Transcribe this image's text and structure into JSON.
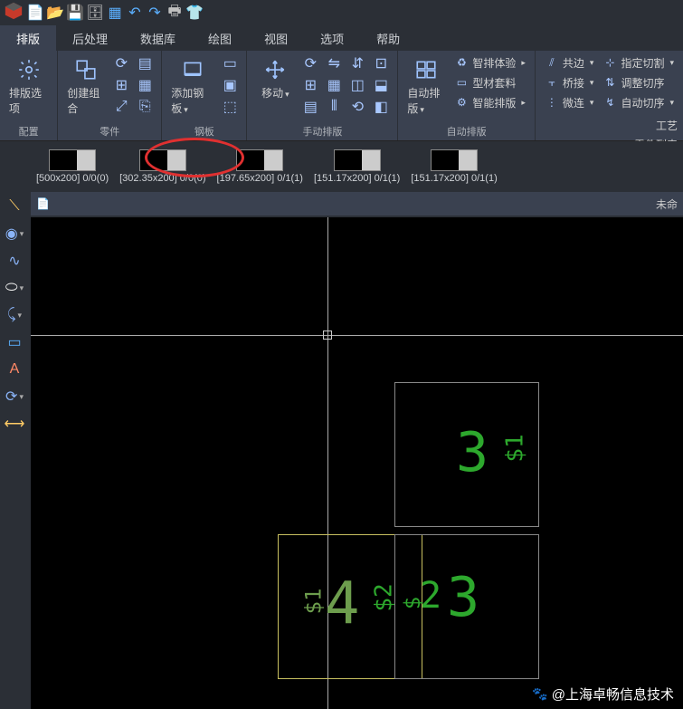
{
  "qat": {
    "items": [
      "new",
      "open",
      "save",
      "saveall",
      "grid",
      "undo",
      "redo",
      "print",
      "highlight"
    ]
  },
  "menu": {
    "tabs": [
      "排版",
      "后处理",
      "数据库",
      "绘图",
      "视图",
      "选项",
      "帮助"
    ],
    "active": 0
  },
  "ribbon": {
    "groups": {
      "config": {
        "label": "配置",
        "btn": "排版选项"
      },
      "parts": {
        "label": "零件",
        "btn": "创建组合"
      },
      "steel": {
        "label": "钢板",
        "btn": "添加钢板"
      },
      "manual": {
        "label": "手动排版",
        "btn": "移动"
      },
      "auto": {
        "label": "自动排版",
        "btn": "自动排版",
        "items": [
          "智排体验",
          "型材套料",
          "智能排版"
        ]
      },
      "edit": {
        "col1": [
          "共边",
          "桥接",
          "微连"
        ],
        "col2": [
          "指定切割",
          "调整切序",
          "自动切序"
        ]
      },
      "craft": {
        "label": "工艺",
        "extra": "零件列表"
      }
    }
  },
  "thumbs": [
    {
      "label": "[500x200] 0/0(0)"
    },
    {
      "label": "[302.35x200] 0/0(0)"
    },
    {
      "label": "[197.65x200] 0/1(1)"
    },
    {
      "label": "[151.17x200] 0/1(1)"
    },
    {
      "label": "[151.17x200] 0/1(1)"
    }
  ],
  "canvas": {
    "title_icon": "📄",
    "title_right": "未命",
    "shapes": {
      "top_right": "3",
      "top_right_side": "$1",
      "bottom_left": "4",
      "bottom_left_side": "$1",
      "bottom_mid_a": "$2",
      "bottom_right": "3",
      "bottom_right_pre": "2",
      "bottom_right_side": "$"
    }
  },
  "right_panel": {
    "craft": "工艺",
    "parts_list": "零件列表"
  },
  "watermark": "@上海卓畅信息技术"
}
